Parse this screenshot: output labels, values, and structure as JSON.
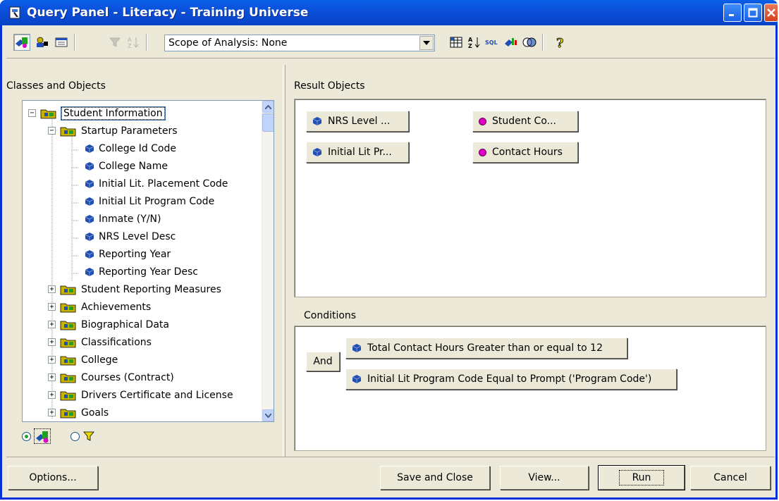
{
  "window": {
    "title": "Query Panel - Literacy - Training Universe"
  },
  "toolbar": {
    "scope_label": "Scope of Analysis: None"
  },
  "left_panel": {
    "header": "Classes and Objects",
    "tree": [
      {
        "label": "Student Information",
        "kind": "class",
        "expander": "−",
        "level": 0,
        "selected": true
      },
      {
        "label": "Startup Parameters",
        "kind": "class",
        "expander": "−",
        "level": 1
      },
      {
        "label": "College Id Code",
        "kind": "object",
        "level": 2
      },
      {
        "label": "College Name",
        "kind": "object",
        "level": 2
      },
      {
        "label": "Initial Lit. Placement Code",
        "kind": "object",
        "level": 2
      },
      {
        "label": "Initial Lit Program Code",
        "kind": "object",
        "level": 2
      },
      {
        "label": "Inmate (Y/N)",
        "kind": "object",
        "level": 2
      },
      {
        "label": "NRS Level Desc",
        "kind": "object",
        "level": 2
      },
      {
        "label": "Reporting Year",
        "kind": "object",
        "level": 2
      },
      {
        "label": "Reporting Year Desc",
        "kind": "object",
        "level": 2
      },
      {
        "label": "Student Reporting Measures",
        "kind": "class",
        "expander": "+",
        "level": 1
      },
      {
        "label": "Achievements",
        "kind": "class",
        "expander": "+",
        "level": 1
      },
      {
        "label": "Biographical Data",
        "kind": "class",
        "expander": "+",
        "level": 1
      },
      {
        "label": "Classifications",
        "kind": "class",
        "expander": "+",
        "level": 1
      },
      {
        "label": "College",
        "kind": "class",
        "expander": "+",
        "level": 1
      },
      {
        "label": "Courses (Contract)",
        "kind": "class",
        "expander": "+",
        "level": 1
      },
      {
        "label": "Drivers Certificate and License",
        "kind": "class",
        "expander": "+",
        "level": 1
      },
      {
        "label": "Goals",
        "kind": "class",
        "expander": "+",
        "level": 1
      }
    ]
  },
  "result_objects": {
    "header": "Result Objects",
    "items": [
      {
        "label": "NRS Level ...",
        "kind": "object"
      },
      {
        "label": "Student Co...",
        "kind": "dimension"
      },
      {
        "label": "Initial Lit Pr...",
        "kind": "object"
      },
      {
        "label": "Contact Hours",
        "kind": "dimension"
      }
    ]
  },
  "conditions": {
    "header": "Conditions",
    "operator": "And",
    "items": [
      {
        "label": "Total Contact Hours Greater than or equal to 12"
      },
      {
        "label": "Initial Lit Program Code Equal to Prompt ('Program Code')"
      }
    ]
  },
  "buttons": {
    "options": "Options...",
    "save_close": "Save and Close",
    "view": "View...",
    "run": "Run",
    "cancel": "Cancel"
  },
  "colors": {
    "title_bar": "#0a4ed8",
    "window_bg": "#ece9d8",
    "object_icon": "#1f4fb4",
    "dimension_dot": "#e000c8",
    "folder": "#c8b400"
  }
}
